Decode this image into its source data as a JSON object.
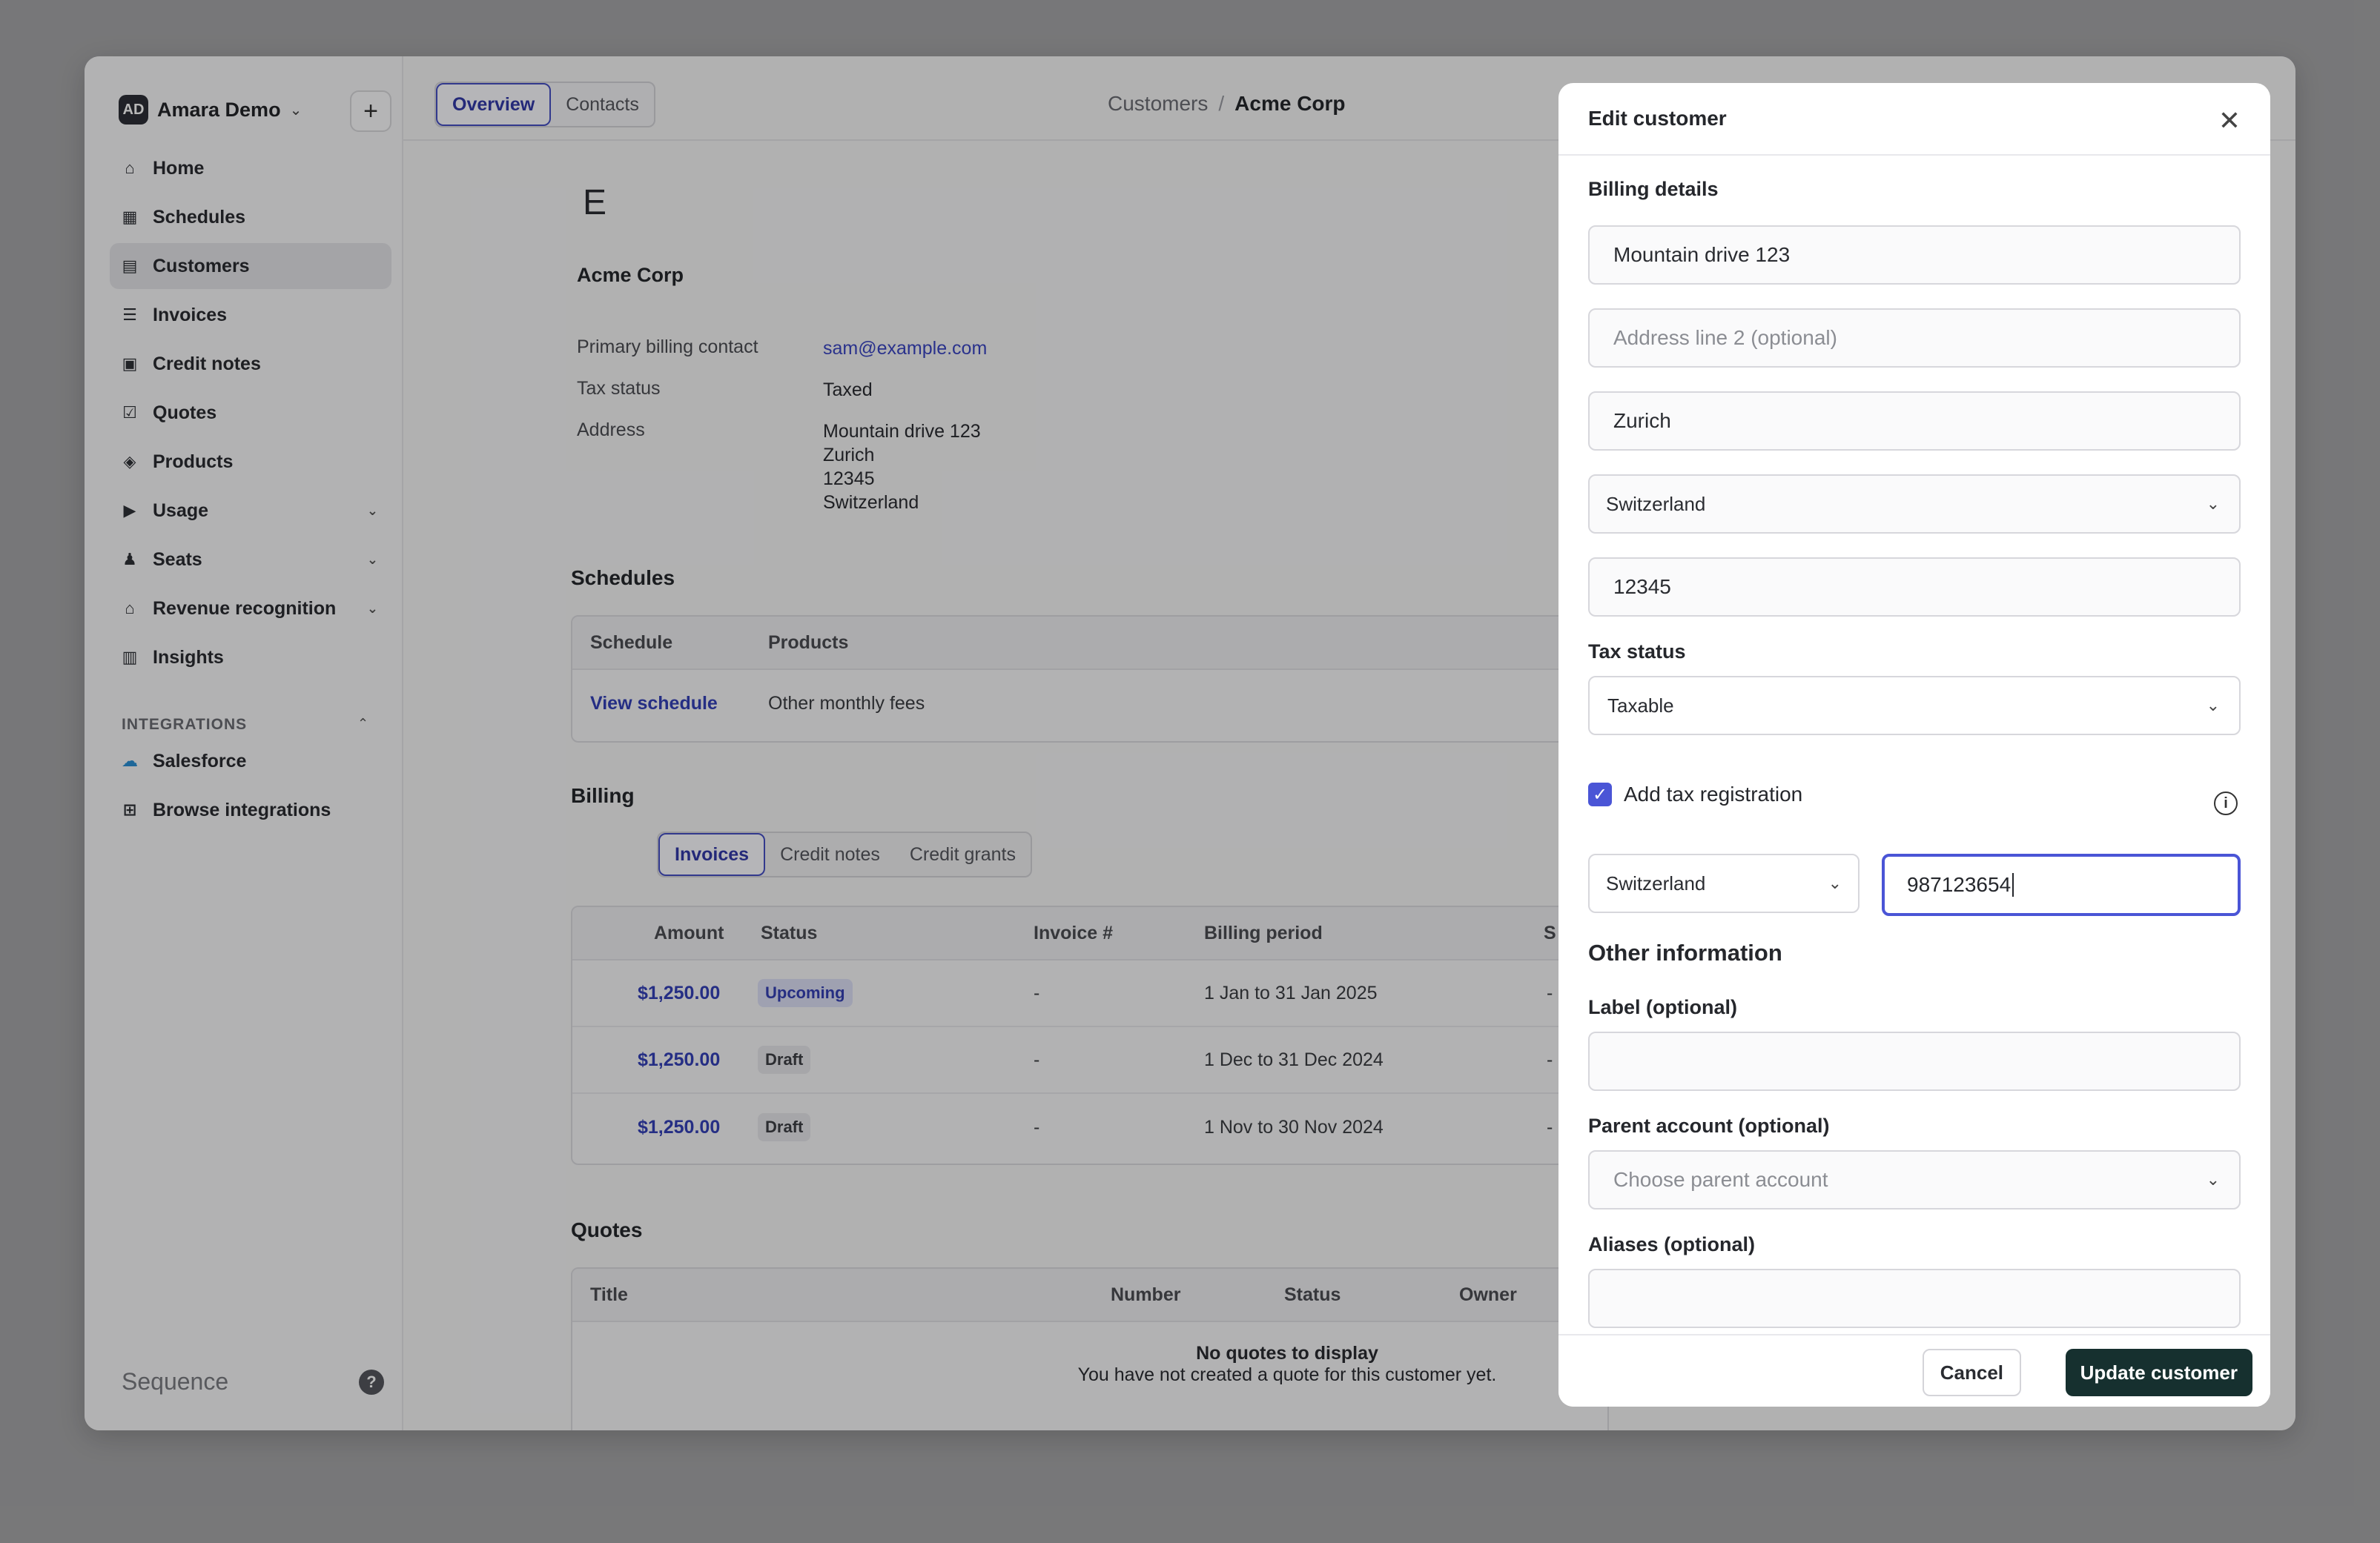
{
  "workspace": {
    "avatar": "AD",
    "name": "Amara Demo",
    "add_label": "+"
  },
  "sidebar": {
    "items": [
      {
        "label": "Home",
        "icon": "home-icon"
      },
      {
        "label": "Schedules",
        "icon": "calendar-icon"
      },
      {
        "label": "Customers",
        "icon": "id-card-icon"
      },
      {
        "label": "Invoices",
        "icon": "stack-icon"
      },
      {
        "label": "Credit notes",
        "icon": "note-icon"
      },
      {
        "label": "Quotes",
        "icon": "check-doc-icon"
      },
      {
        "label": "Products",
        "icon": "box-icon"
      },
      {
        "label": "Usage",
        "icon": "terminal-icon"
      },
      {
        "label": "Seats",
        "icon": "users-icon"
      },
      {
        "label": "Revenue recognition",
        "icon": "bank-icon"
      },
      {
        "label": "Insights",
        "icon": "chart-icon"
      }
    ],
    "integrations_label": "INTEGRATIONS",
    "integrations": [
      {
        "label": "Salesforce",
        "icon": "salesforce-icon"
      },
      {
        "label": "Browse integrations",
        "icon": "grid-plus-icon"
      }
    ],
    "brand": "Sequence",
    "help": "?"
  },
  "header": {
    "tabs": [
      "Overview",
      "Contacts"
    ],
    "breadcrumb": {
      "parent": "Customers",
      "current": "Acme Corp"
    }
  },
  "customer": {
    "logo_letter": "E",
    "name": "Acme Corp",
    "contact_label": "Primary billing contact",
    "contact_value": "sam@example.com",
    "tax_label": "Tax status",
    "tax_value": "Taxed",
    "address_label": "Address",
    "address_lines": [
      "Mountain drive 123",
      "Zurich",
      "12345",
      "Switzerland"
    ]
  },
  "schedules": {
    "title": "Schedules",
    "headers": [
      "Schedule",
      "Products"
    ],
    "row": {
      "schedule": "View schedule",
      "products": "Other monthly fees"
    }
  },
  "billing": {
    "title": "Billing",
    "tabs": [
      "Invoices",
      "Credit notes",
      "Credit grants"
    ],
    "headers": [
      "Amount",
      "Status",
      "Invoice #",
      "Billing period",
      "S"
    ],
    "rows": [
      {
        "amount": "$1,250.00",
        "status": "Upcoming",
        "invoice": "-",
        "period": "1 Jan to 31 Jan 2025",
        "extra": "-"
      },
      {
        "amount": "$1,250.00",
        "status": "Draft",
        "invoice": "-",
        "period": "1 Dec to 31 Dec 2024",
        "extra": "-"
      },
      {
        "amount": "$1,250.00",
        "status": "Draft",
        "invoice": "-",
        "period": "1 Nov to 30 Nov 2024",
        "extra": "-"
      }
    ]
  },
  "quotes": {
    "title": "Quotes",
    "headers": [
      "Title",
      "Number",
      "Status",
      "Owner"
    ],
    "empty_title": "No quotes to display",
    "empty_sub": "You have not created a quote for this customer yet."
  },
  "modal": {
    "title": "Edit customer",
    "close": "✕",
    "billing_title": "Billing details",
    "address1": "Mountain drive 123",
    "address2_placeholder": "Address line 2 (optional)",
    "city": "Zurich",
    "country": "Switzerland",
    "postcode": "12345",
    "tax_status_label": "Tax status",
    "tax_status_value": "Taxable",
    "add_tax_reg_label": "Add tax registration",
    "tax_country": "Switzerland",
    "tax_id": "987123654",
    "other_title": "Other information",
    "label_label": "Label (optional)",
    "parent_label": "Parent account (optional)",
    "parent_placeholder": "Choose parent account",
    "aliases_label": "Aliases (optional)",
    "cancel": "Cancel",
    "update": "Update customer"
  }
}
